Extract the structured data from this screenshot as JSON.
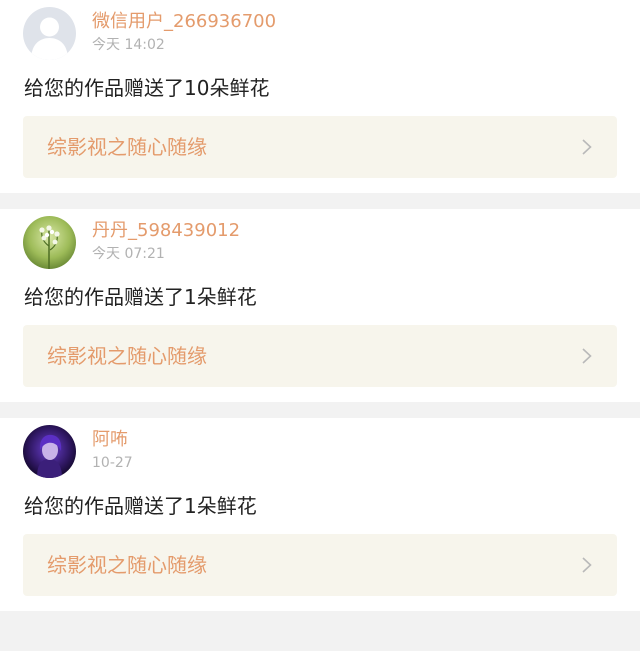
{
  "colors": {
    "accent": "#e49b6c",
    "text": "#222222",
    "muted": "#b2b2b2",
    "link_bg": "#f7f5ec",
    "page_bg": "#f2f2f2"
  },
  "notifications": [
    {
      "user_name": "微信用户_266936700",
      "time": "今天 14:02",
      "message": "给您的作品赠送了10朵鲜花",
      "work_title": "综影视之随心随缘",
      "avatar": "default-user-avatar",
      "chevron": "chevron-right-icon"
    },
    {
      "user_name": "丹丹_598439012",
      "time": "今天 07:21",
      "message": "给您的作品赠送了1朵鲜花",
      "work_title": "综影视之随心随缘",
      "avatar": "green-plant-avatar",
      "chevron": "chevron-right-icon"
    },
    {
      "user_name": "阿咘",
      "time": "10-27",
      "message": "给您的作品赠送了1朵鲜花",
      "work_title": "综影视之随心随缘",
      "avatar": "purple-portrait-avatar",
      "chevron": "chevron-right-icon"
    }
  ]
}
